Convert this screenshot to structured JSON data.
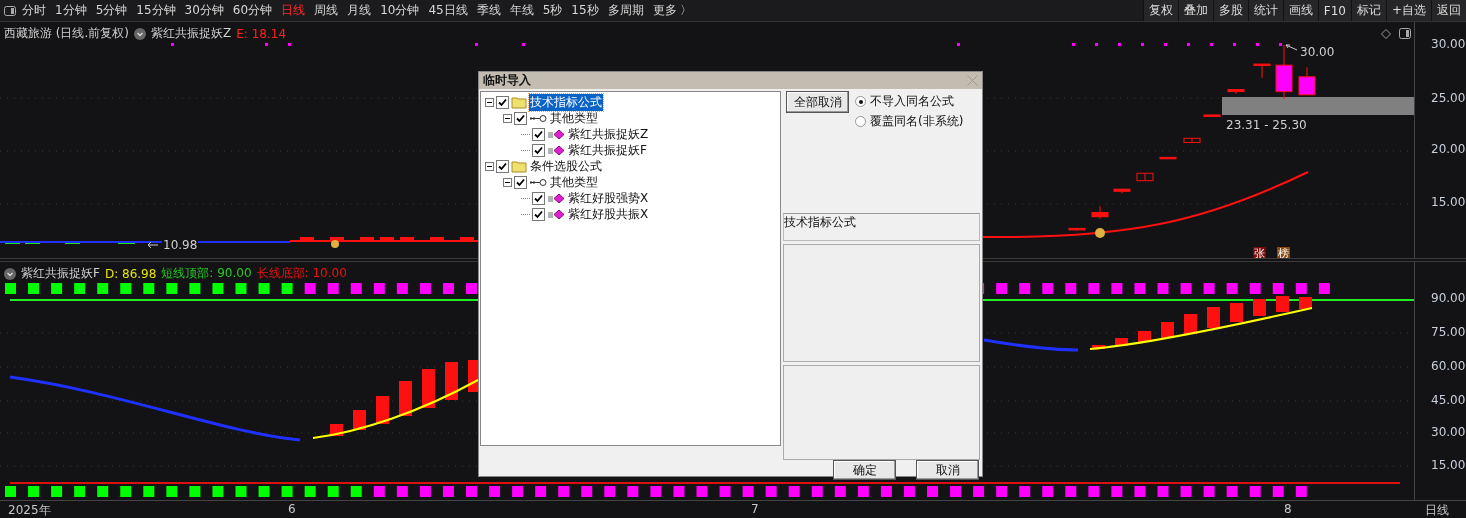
{
  "toolbar": {
    "periods": [
      {
        "label": "分时",
        "selected": false
      },
      {
        "label": "1分钟",
        "selected": false
      },
      {
        "label": "5分钟",
        "selected": false
      },
      {
        "label": "15分钟",
        "selected": false
      },
      {
        "label": "30分钟",
        "selected": false
      },
      {
        "label": "60分钟",
        "selected": false
      },
      {
        "label": "日线",
        "selected": true
      },
      {
        "label": "周线",
        "selected": false
      },
      {
        "label": "月线",
        "selected": false
      },
      {
        "label": "10分钟",
        "selected": false
      },
      {
        "label": "45日线",
        "selected": false
      },
      {
        "label": "季线",
        "selected": false
      },
      {
        "label": "年线",
        "selected": false
      },
      {
        "label": "5秒",
        "selected": false
      },
      {
        "label": "15秒",
        "selected": false
      },
      {
        "label": "多周期",
        "selected": false
      },
      {
        "label": "更多 〉",
        "selected": false
      }
    ],
    "tools": [
      "复权",
      "叠加",
      "多股",
      "统计",
      "画线",
      "F10",
      "标记",
      "+自选",
      "返回"
    ]
  },
  "price_panel": {
    "title": "西藏旅游 (日线.前复权)",
    "indicator": "紫红共振捉妖Z",
    "reading": "E: 18.14",
    "high_label": "30.00",
    "range_label": "23.31 - 25.30",
    "low_label": "10.98",
    "badges": [
      {
        "text": "张",
        "color": "#7a0a0a"
      },
      {
        "text": "榜",
        "color": "#8a4a10"
      }
    ],
    "axis": [
      "30.00",
      "25.00",
      "20.00",
      "15.00"
    ]
  },
  "indicator_panel": {
    "name": "紫红共振捉妖F",
    "readings": [
      {
        "text": "D: 86.98",
        "color": "#e6e600"
      },
      {
        "text": "短线顶部: 90.00",
        "color": "#22cc22"
      },
      {
        "text": "长线底部: 10.00",
        "color": "#ee1111"
      }
    ],
    "axis": [
      "90.00",
      "75.00",
      "60.00",
      "45.00",
      "30.00",
      "15.00"
    ]
  },
  "time_axis": {
    "labels": [
      "2025年",
      "6",
      "7",
      "8"
    ],
    "period": "日线"
  },
  "dialog": {
    "title": "临时导入",
    "tree": [
      {
        "label": "技术指标公式",
        "kind": "folder",
        "checked": true,
        "selected": true,
        "expanded": true,
        "children": [
          {
            "label": "其他类型",
            "kind": "type",
            "checked": true,
            "selected": false,
            "expanded": true,
            "children": [
              {
                "label": "紫红共振捉妖Z",
                "kind": "formula",
                "checked": true,
                "selected": false
              },
              {
                "label": "紫红共振捉妖F",
                "kind": "formula",
                "checked": true,
                "selected": false
              }
            ]
          }
        ]
      },
      {
        "label": "条件选股公式",
        "kind": "folder",
        "checked": true,
        "selected": false,
        "expanded": true,
        "children": [
          {
            "label": "其他类型",
            "kind": "type",
            "checked": true,
            "selected": false,
            "expanded": true,
            "children": [
              {
                "label": "紫红好股强势X",
                "kind": "formula",
                "checked": true,
                "selected": false
              },
              {
                "label": "紫红好股共振X",
                "kind": "formula",
                "checked": true,
                "selected": false
              }
            ]
          }
        ]
      }
    ],
    "clear_button": "全部取消",
    "options": [
      {
        "label": "不导入同名公式",
        "selected": true
      },
      {
        "label": "覆盖同名(非系统)",
        "selected": false
      }
    ],
    "info_label": "技术指标公式",
    "buttons": [
      "确定",
      "取消"
    ]
  }
}
